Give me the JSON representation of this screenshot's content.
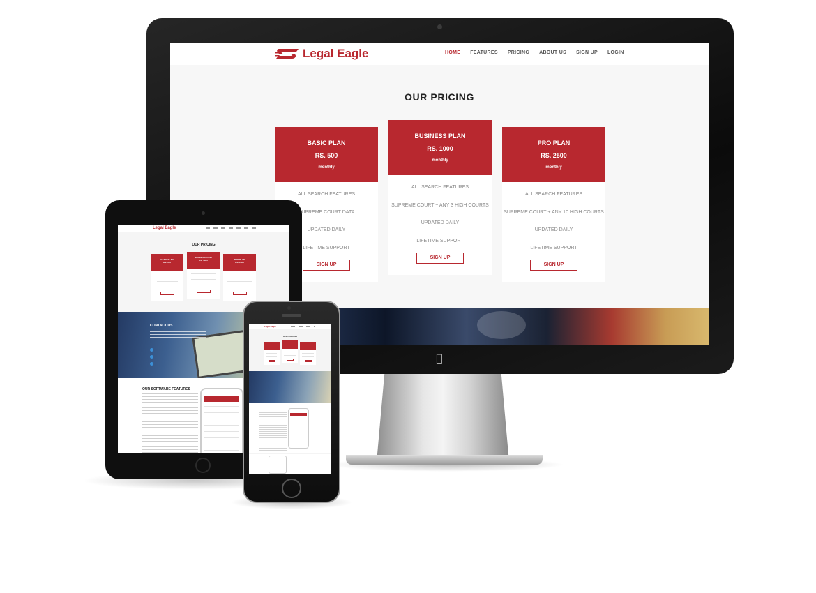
{
  "site": {
    "brand": "Legal Eagle",
    "nav": [
      "HOME",
      "FEATURES",
      "PRICING",
      "ABOUT US",
      "SIGN UP",
      "LOGIN"
    ],
    "active_nav": "HOME",
    "pricing_title": "OUR PRICING",
    "plans": [
      {
        "name": "BASIC PLAN",
        "price": "RS. 500",
        "period": "monthly",
        "features": [
          "ALL SEARCH FEATURES",
          "SUPREME COURT DATA",
          "UPDATED DAILY",
          "LIFETIME SUPPORT"
        ],
        "button": "SIGN UP"
      },
      {
        "name": "BUSINESS PLAN",
        "price": "RS. 1000",
        "period": "monthly",
        "features": [
          "ALL SEARCH FEATURES",
          "SUPREME COURT + ANY 3 HIGH COURTS",
          "UPDATED DAILY",
          "LIFETIME SUPPORT"
        ],
        "button": "SIGN UP"
      },
      {
        "name": "PRO PLAN",
        "price": "RS. 2500",
        "period": "monthly",
        "features": [
          "ALL SEARCH FEATURES",
          "SUPREME COURT + ANY 10 HIGH COURTS",
          "UPDATED DAILY",
          "LIFETIME SUPPORT"
        ],
        "button": "SIGN UP"
      }
    ],
    "contact_title": "CONTACT US",
    "features_title": "OUR SOFTWARE FEATURES"
  },
  "colors": {
    "brand_red": "#b8282f",
    "device_black": "#0f0f0f",
    "page_bg": "#f7f7f7"
  },
  "icons": {
    "apple_logo": "apple-logo-icon",
    "brand_logo": "legal-eagle-logo-icon"
  }
}
